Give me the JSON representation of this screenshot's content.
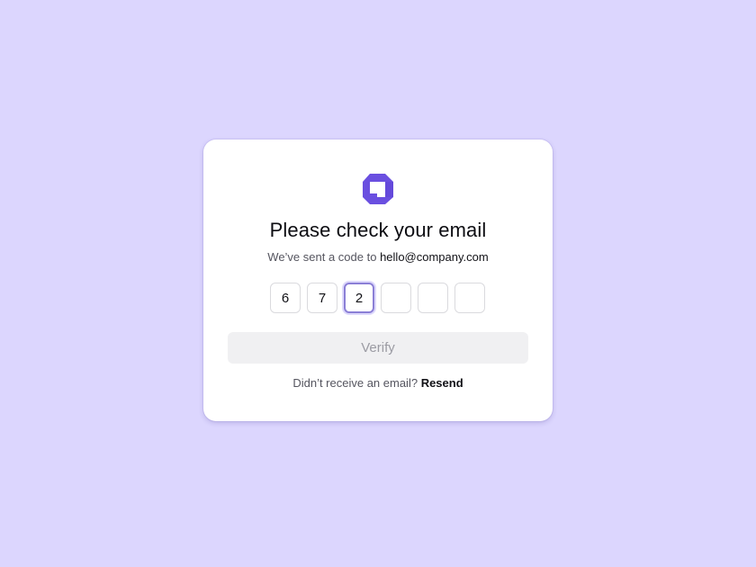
{
  "card": {
    "logo_icon": "brand-logo-icon",
    "title": "Please check your email",
    "subtitle_prefix": "We’ve sent a code to",
    "email": "hello@company.com"
  },
  "code": {
    "digits": [
      "6",
      "7",
      "2",
      "",
      "",
      ""
    ],
    "active_index": 2
  },
  "verify_button": {
    "label": "Verify"
  },
  "resend": {
    "prompt": "Didn’t receive an email?",
    "link_label": "Resend"
  },
  "colors": {
    "background": "#dcd6fe",
    "brand": "#6a4fe0",
    "focus_ring": "#8b7fd6"
  }
}
